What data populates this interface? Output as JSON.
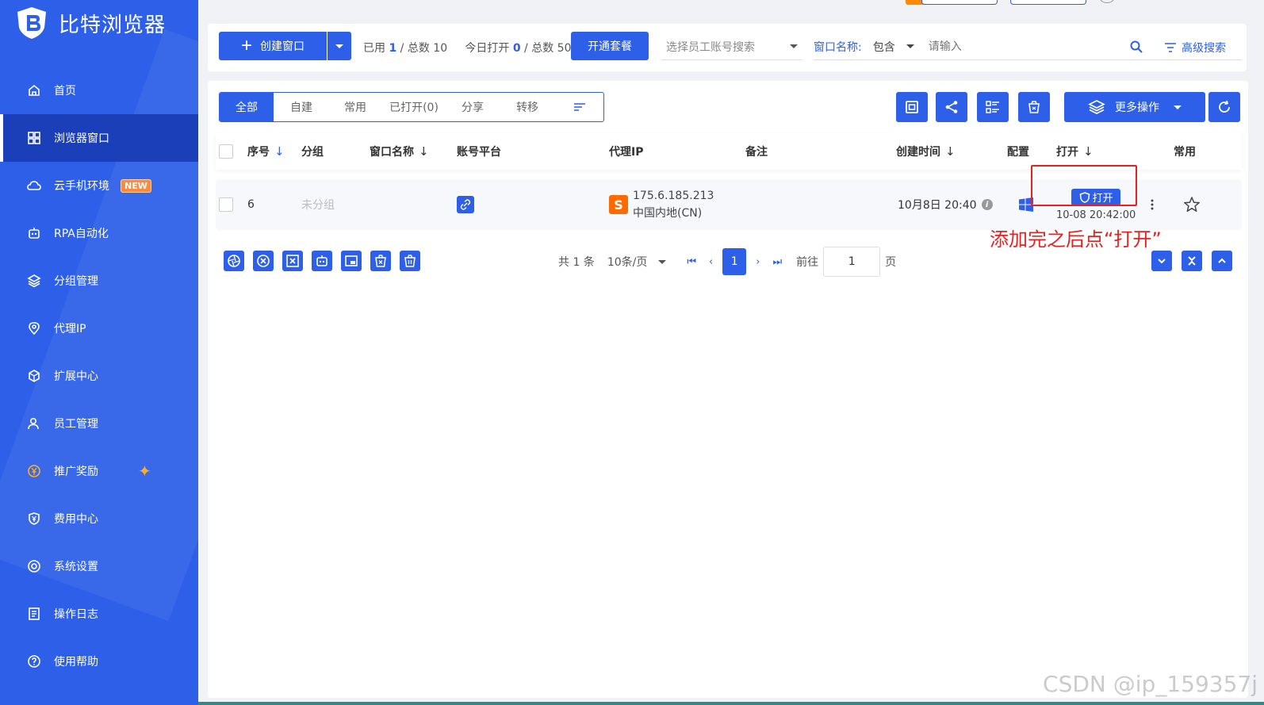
{
  "brand": {
    "name": "比特浏览器"
  },
  "sidebar": {
    "items": [
      {
        "label": "首页",
        "icon": "home-icon"
      },
      {
        "label": "浏览器窗口",
        "icon": "grid-icon",
        "active": true
      },
      {
        "label": "云手机环境",
        "icon": "cloud-icon",
        "badge": "NEW"
      },
      {
        "label": "RPA自动化",
        "icon": "robot-icon"
      },
      {
        "label": "分组管理",
        "icon": "layers-icon"
      },
      {
        "label": "代理IP",
        "icon": "location-icon"
      },
      {
        "label": "扩展中心",
        "icon": "cube-icon"
      },
      {
        "label": "员工管理",
        "icon": "users-icon"
      },
      {
        "label": "推广奖励",
        "icon": "yuan-icon",
        "sparkle": "✦"
      },
      {
        "label": "费用中心",
        "icon": "shield-yuan-icon"
      },
      {
        "label": "系统设置",
        "icon": "settings-icon"
      },
      {
        "label": "操作日志",
        "icon": "log-icon"
      },
      {
        "label": "使用帮助",
        "icon": "help-icon"
      }
    ]
  },
  "toolbar": {
    "create_label": "创建窗口",
    "used_label": "已用",
    "used_value": "1",
    "total_label": "/ 总数",
    "total_value": "10",
    "today_label": "今日打开",
    "today_value": "0",
    "today_total_label": "/ 总数",
    "today_total_value": "50",
    "plan_label": "开通套餐",
    "employee_placeholder": "选择员工账号搜索",
    "window_name_label": "窗口名称:",
    "match_mode": "包含",
    "search_placeholder": "请输入",
    "advanced_label": "高级搜索"
  },
  "tabs": [
    "全部",
    "自建",
    "常用",
    "已打开(0)",
    "分享",
    "转移"
  ],
  "actions": {
    "more_label": "更多操作"
  },
  "table": {
    "headers": {
      "index": "序号",
      "group": "分组",
      "window_name": "窗口名称",
      "platform": "账号平台",
      "proxy": "代理IP",
      "note": "备注",
      "created": "创建时间",
      "config": "配置",
      "open": "打开",
      "favorite": "常用"
    },
    "rows": [
      {
        "index": "6",
        "group": "未分组",
        "proxy_ip": "175.6.185.213",
        "proxy_region": "中国内地(CN)",
        "proxy_tag": "S",
        "created": "10月8日 20:40",
        "open_label": "打开",
        "open_time": "10-08 20:42:00"
      }
    ]
  },
  "annotation": "添加完之后点“打开”",
  "pagination": {
    "total": "共 1 条",
    "page_size": "10条/页",
    "current": "1",
    "goto_label": "前往",
    "goto_value": "1",
    "page_suffix": "页"
  },
  "watermark": "CSDN @ip_159357j",
  "colors": {
    "primary": "#2d5fe8",
    "sidebar": "#2d5fe8",
    "active": "#1a3fb8",
    "annotation": "#e82020",
    "proxy_tag": "#ff6a00"
  }
}
